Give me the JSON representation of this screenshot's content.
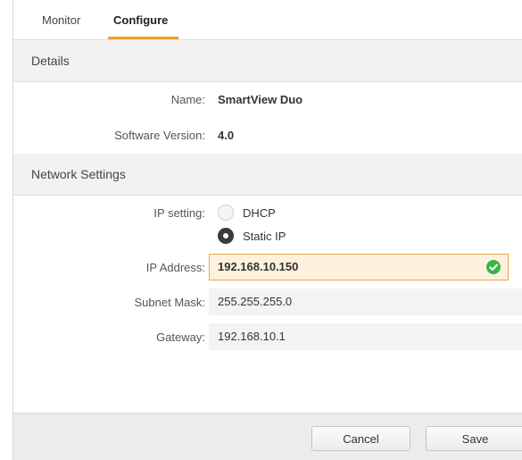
{
  "tabs": {
    "monitor": "Monitor",
    "configure": "Configure"
  },
  "details": {
    "header": "Details",
    "name_label": "Name:",
    "name_value": "SmartView Duo",
    "software_label": "Software Version:",
    "software_value": "4.0"
  },
  "network": {
    "header": "Network Settings",
    "ip_setting_label": "IP setting:",
    "dhcp_label": "DHCP",
    "static_label": "Static IP",
    "selected": "Static IP",
    "ip_address_label": "IP Address:",
    "ip_address_value": "192.168.10.150",
    "subnet_label": "Subnet Mask:",
    "subnet_value": "255.255.255.0",
    "gateway_label": "Gateway:",
    "gateway_value": "192.168.10.1"
  },
  "footer": {
    "cancel_label": "Cancel",
    "save_label": "Save"
  },
  "colors": {
    "accent": "#f0a12c",
    "valid": "#39b54a"
  },
  "icons": {
    "valid": "check-circle-icon"
  }
}
